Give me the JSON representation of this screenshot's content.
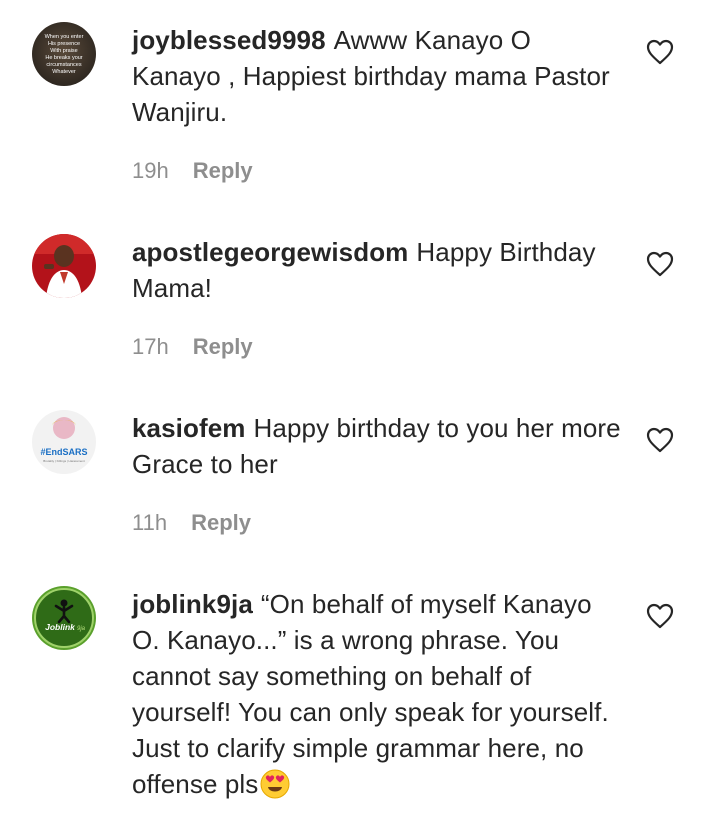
{
  "comments": [
    {
      "username": "joyblessed9998",
      "text": "Awww Kanayo O Kanayo , Happiest birthday mama Pastor Wanjiru.",
      "time": "19h",
      "reply_label": "Reply",
      "avatar_text": [
        "When you enter",
        "His presence",
        "With praise",
        "He breaks your",
        "circumstances",
        "Whatever"
      ]
    },
    {
      "username": "apostlegeorgewisdom",
      "text": "Happy Birthday Mama!",
      "time": "17h",
      "reply_label": "Reply"
    },
    {
      "username": "kasiofem",
      "text": "Happy birthday to you her more Grace to her",
      "time": "11h",
      "reply_label": "Reply",
      "avatar_text": [
        "#EndSARS",
        "Brutality | Killings | Harassment"
      ]
    },
    {
      "username": "joblink9ja",
      "text": "“On behalf of myself Kanayo O. Kanayo...” is a wrong phrase. You cannot say something on behalf of yourself! You can only speak for yourself. Just to clarify simple grammar here, no offense pls",
      "time": "",
      "reply_label": "",
      "avatar_text": [
        "Joblink",
        "9ja"
      ],
      "trailing_emoji": "heart-eyes-emoji"
    }
  ],
  "colors": {
    "text": "#262626",
    "meta": "#8e8e8e",
    "background": "#ffffff"
  }
}
